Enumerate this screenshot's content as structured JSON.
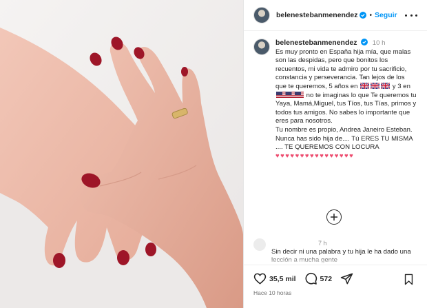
{
  "post": {
    "username": "belenestebanmenendez",
    "follow_label": "Seguir",
    "dot": "•",
    "caption_time": "10 h",
    "caption_part1": "Es muy pronto en España hija mía, que malas son las despidas, pero que bonitos los recuentos, mi vida te admiro por tu sacrificio, constancia y perseverancia. Tan lejos de los que te queremos, 5 años en ",
    "caption_part2": " y 3 en ",
    "caption_part3": " no te imaginas lo que Te queremos tu Yaya, Mamá,Miguel, tus Tíos, tus Tías, primos y todos tus amigos. No sabes lo importante que eres para nosotros.\nTu nombre es propio, Andrea Janeiro Esteban. Nunca has sido hija de.... Tú ERES TU MISMA .... TE QUEREMOS CON LOCURA ",
    "hearts": "♥♥♥♥♥♥♥♥♥♥♥♥♥♥♥♥",
    "comment_time": "7 h",
    "comment_text": "Sin decir ni una palabra y tu hija le ha dado una lección a mucha gente",
    "likes": "35,5 mil",
    "comments": "572",
    "posted_ago": "Hace 10 horas"
  },
  "icons": {
    "verified": "verified-badge-icon",
    "more": "more-options-icon",
    "add": "add-circle-icon",
    "like": "heart-icon",
    "comment": "comment-bubble-icon",
    "share": "paper-plane-icon",
    "save": "bookmark-icon",
    "flag_uk": "uk-flag-icon",
    "flag_us": "us-flag-icon"
  },
  "colors": {
    "accent": "#0095f6",
    "heart": "#ed4a6d",
    "nail": "#9e1628",
    "text": "#262626",
    "muted": "#8e8e8e"
  }
}
